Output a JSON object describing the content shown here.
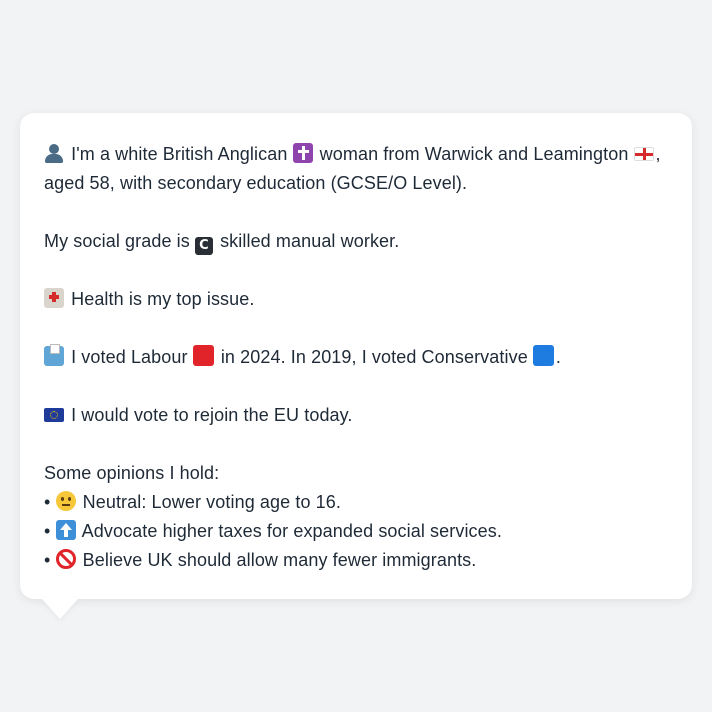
{
  "profile": {
    "intro_line1": "I'm a white British Anglican",
    "intro_line1b": "woman from Warwick and Leamington",
    "intro_line1c": ",",
    "intro_line2": "aged 58, with secondary education (GCSE/O Level).",
    "social_grade_prefix": "My social grade is",
    "social_grade_suffix": "skilled manual worker.",
    "top_issue": "Health is my top issue.",
    "vote_a": "I voted Labour",
    "vote_b": "in 2024. In 2019, I voted Conservative",
    "vote_c": ".",
    "eu": "I would vote to rejoin the EU today.",
    "opinions_heading": "Some opinions I hold:",
    "opinions": [
      {
        "bullet": "•",
        "icon": "neutral-face-icon",
        "text": "Neutral: Lower voting age to 16."
      },
      {
        "bullet": "•",
        "icon": "up-arrow-icon",
        "text": "Advocate higher taxes for expanded social services."
      },
      {
        "bullet": "•",
        "icon": "prohibited-icon",
        "text": "Believe UK should allow many fewer immigrants."
      }
    ]
  },
  "icons": {
    "person": "person-silhouette-icon",
    "cross": "latin-cross-icon",
    "england_flag": "england-flag-icon",
    "letter_c": "letter-c-icon",
    "hospital": "hospital-icon",
    "ballot": "ballot-box-icon",
    "labour": "red-square-icon",
    "conservative": "blue-square-icon",
    "eu_flag": "eu-flag-icon"
  },
  "colors": {
    "background": "#f1f3f5",
    "card": "#ffffff",
    "text": "#1f2a37",
    "labour_red": "#e0242a",
    "conservative_blue": "#1e7be0"
  }
}
